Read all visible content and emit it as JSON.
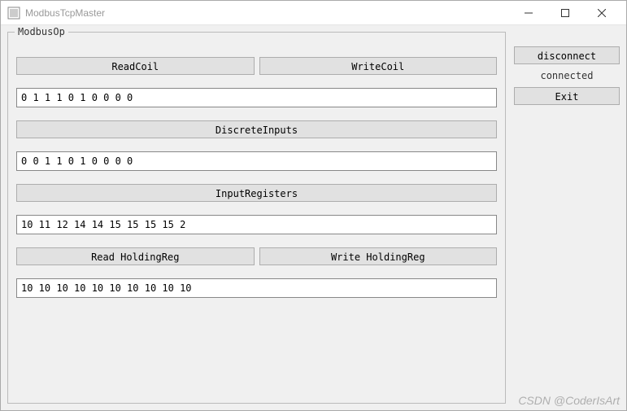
{
  "window": {
    "title": "ModbusTcpMaster"
  },
  "groupbox": {
    "title": "ModbusOp"
  },
  "buttons": {
    "readCoil": "ReadCoil",
    "writeCoil": "WriteCoil",
    "discreteInputs": "DiscreteInputs",
    "inputRegisters": "InputRegisters",
    "readHoldingReg": "Read HoldingReg",
    "writeHoldingReg": "Write HoldingReg"
  },
  "values": {
    "coils": "0 1 1 1 0 1 0 0 0 0",
    "discreteInputs": "0 0 1 1 0 1 0 0 0 0",
    "inputRegisters": "10 11 12 14 14 15 15 15 15 2",
    "holdingRegisters": "10 10 10 10 10 10 10 10 10 10"
  },
  "sidebar": {
    "disconnect": "disconnect",
    "status": "connected",
    "exit": "Exit"
  },
  "watermark": "CSDN @CoderIsArt"
}
